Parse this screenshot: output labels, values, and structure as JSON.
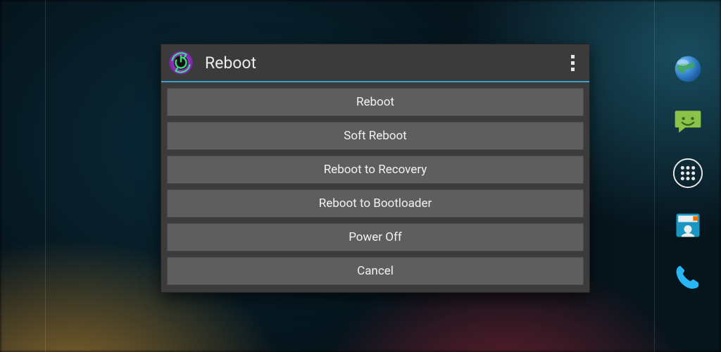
{
  "dialog": {
    "title": "Reboot",
    "options": [
      {
        "label": "Reboot"
      },
      {
        "label": "Soft Reboot"
      },
      {
        "label": "Reboot to Recovery"
      },
      {
        "label": "Reboot to Bootloader"
      },
      {
        "label": "Power Off"
      },
      {
        "label": "Cancel"
      }
    ]
  },
  "colors": {
    "accent": "#39a4c8"
  }
}
